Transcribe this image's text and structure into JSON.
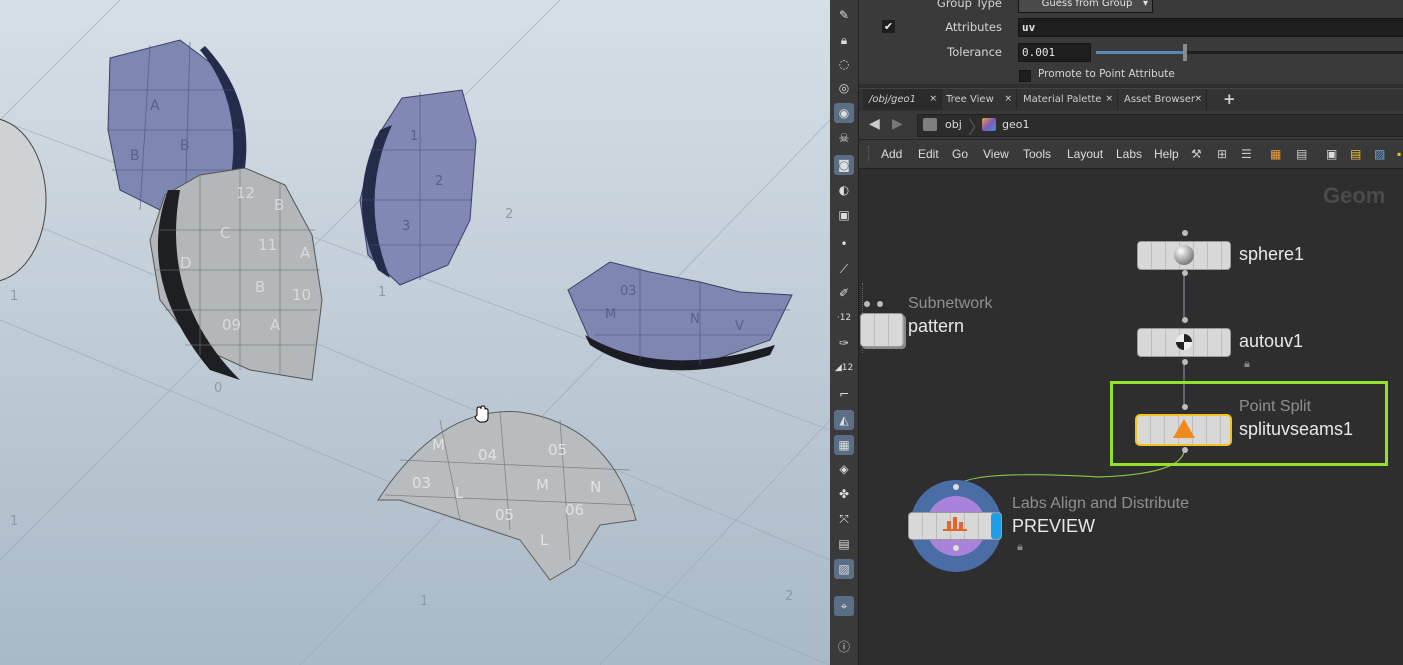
{
  "viewport": {
    "grid_labels": [
      "1",
      "0",
      "1",
      "1",
      "2",
      "1",
      "2"
    ],
    "pieces": [
      {
        "labels": [
          "12",
          "B",
          "A",
          "10",
          "C",
          "D",
          "11",
          "B",
          "09",
          "A"
        ]
      },
      {
        "labels": [
          "A",
          "B",
          "B"
        ]
      },
      {
        "labels": [
          "1",
          "2",
          "3"
        ]
      },
      {
        "labels": [
          "03",
          "M",
          "N",
          "V"
        ]
      },
      {
        "labels": [
          "M",
          "04",
          "05",
          "03",
          "L",
          "M",
          "05",
          "06",
          "N",
          "L"
        ]
      }
    ]
  },
  "params": {
    "group_type_label": "Group Type",
    "group_type_value": "Guess from Group",
    "attributes_label": "Attributes",
    "attributes_value": "uv",
    "tolerance_label": "Tolerance",
    "tolerance_value": "0.001",
    "tolerance_fraction": 0.29,
    "promote_label": "Promote to Point Attribute"
  },
  "tabs": [
    {
      "label": "/obj/geo1"
    },
    {
      "label": "Tree View"
    },
    {
      "label": "Material Palette"
    },
    {
      "label": "Asset Browser"
    }
  ],
  "path": {
    "obj": "obj",
    "geo": "geo1"
  },
  "menu": [
    "Add",
    "Edit",
    "Go",
    "View",
    "Tools",
    "Layout",
    "Labs",
    "Help"
  ],
  "network": {
    "context_label": "Geom",
    "nodes": {
      "sphere": {
        "name": "sphere1"
      },
      "autouv": {
        "name": "autouv1"
      },
      "split": {
        "type": "Point Split",
        "name": "splituvseams1"
      },
      "subnet": {
        "type": "Subnetwork",
        "name": "pattern"
      },
      "labs": {
        "type": "Labs Align and Distribute",
        "name": "PREVIEW"
      }
    }
  },
  "colors": {
    "selection": "#93e12a",
    "current": "#f0c31e",
    "labs_outer": "#4a6da6",
    "labs_inner": "#a982d9",
    "labs_accent": "#1f9de6"
  }
}
